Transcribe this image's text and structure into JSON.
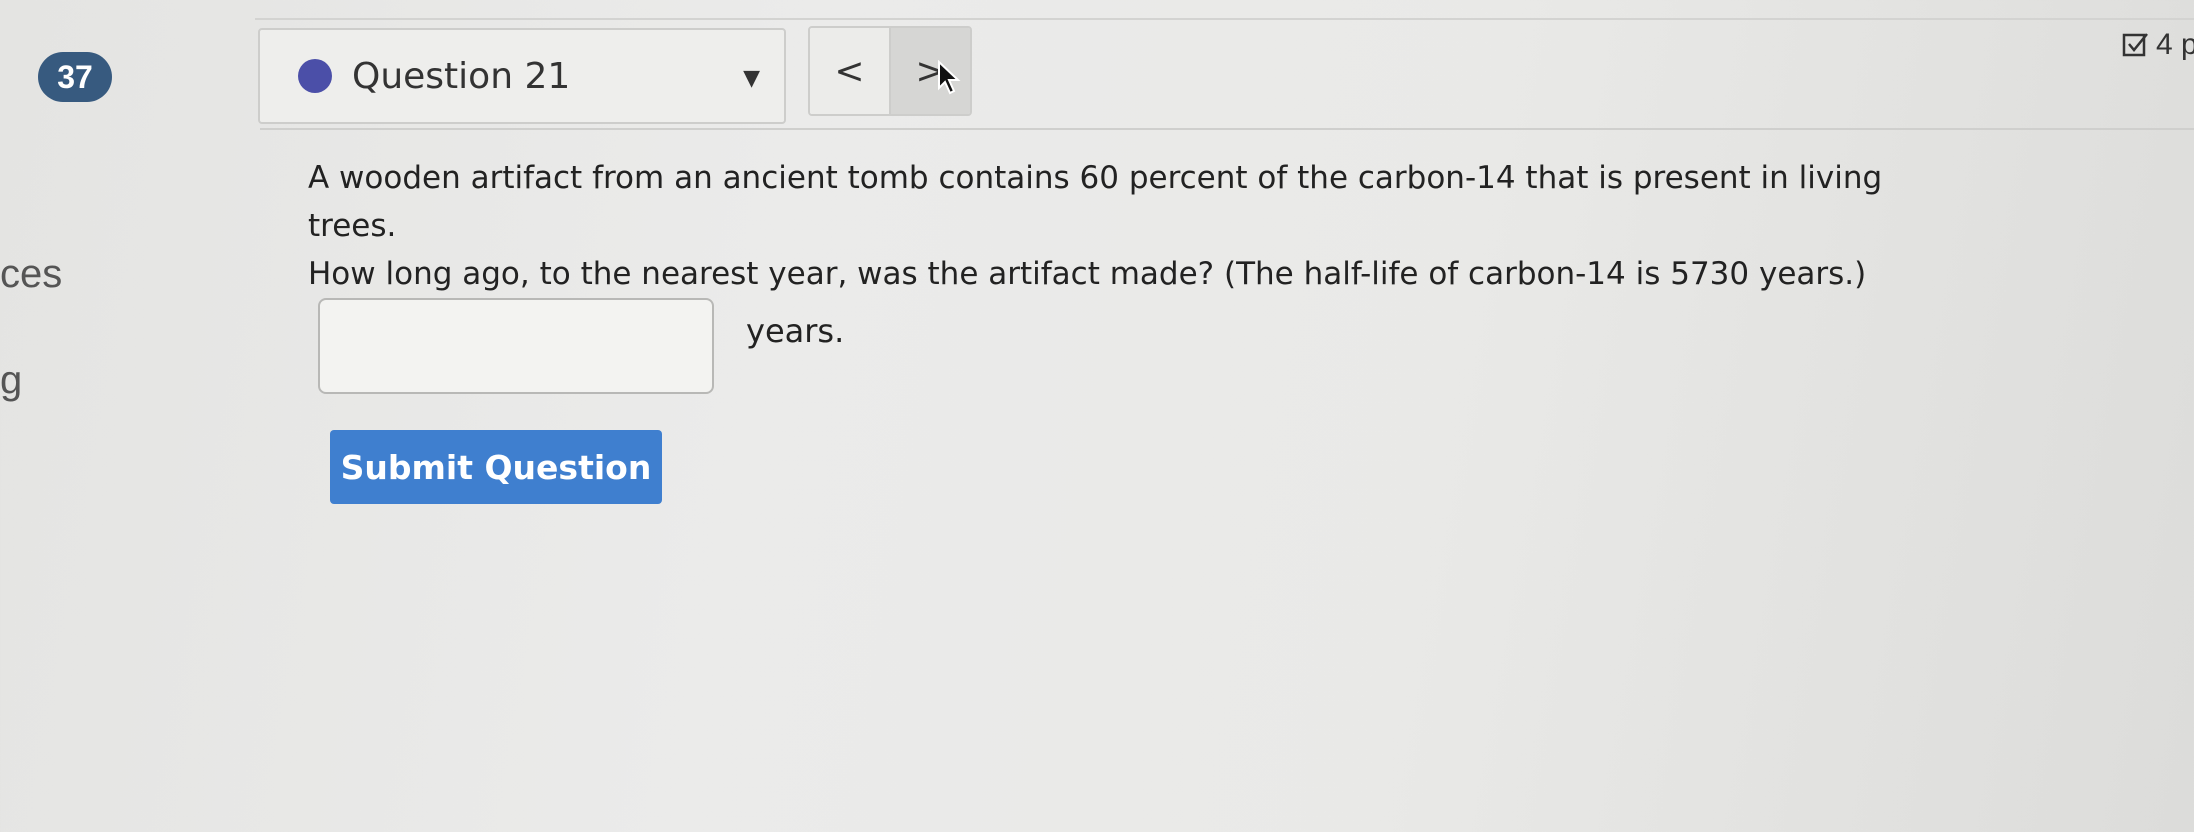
{
  "sidebar": {
    "count_badge": "37",
    "partial_text_1": "ces",
    "partial_text_2": "g"
  },
  "nav": {
    "question_label": "Question 21",
    "prev_symbol": "<",
    "next_symbol": ">",
    "points_label": "4 p"
  },
  "question": {
    "line1": "A wooden artifact from an ancient tomb contains 60 percent of the carbon-14 that is present in living trees.",
    "line2": "How long ago, to the nearest year, was the artifact made? (The half-life of carbon-14 is 5730 years.)",
    "answer_value": "",
    "unit": "years.",
    "submit_label": "Submit Question"
  },
  "colors": {
    "badge": "#375a7f",
    "status_dot": "#4b4fa8",
    "submit": "#3f7fcf"
  }
}
